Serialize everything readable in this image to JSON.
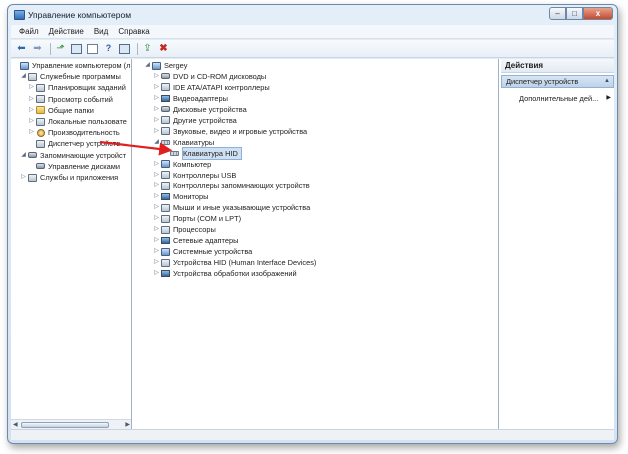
{
  "window": {
    "title": "Управление компьютером",
    "minimize_label": "–",
    "maximize_label": "□",
    "close_label": "x"
  },
  "menu": [
    "Файл",
    "Действие",
    "Вид",
    "Справка"
  ],
  "left_tree": [
    {
      "label": "Управление компьютером (л",
      "level": 0,
      "expander": "",
      "icon": "computer-management-icon"
    },
    {
      "label": "Служебные программы",
      "level": 1,
      "expander": "◢",
      "icon": "tools-icon"
    },
    {
      "label": "Планировщик заданий",
      "level": 2,
      "expander": "▷",
      "icon": "task-scheduler-icon"
    },
    {
      "label": "Просмотр событий",
      "level": 2,
      "expander": "▷",
      "icon": "event-viewer-icon"
    },
    {
      "label": "Общие папки",
      "level": 2,
      "expander": "▷",
      "icon": "shared-folders-icon"
    },
    {
      "label": "Локальные пользовате",
      "level": 2,
      "expander": "▷",
      "icon": "local-users-icon"
    },
    {
      "label": "Производительность",
      "level": 2,
      "expander": "▷",
      "icon": "performance-icon"
    },
    {
      "label": "Диспетчер устройств",
      "level": 2,
      "expander": "",
      "icon": "device-manager-icon"
    },
    {
      "label": "Запоминающие устройст",
      "level": 1,
      "expander": "◢",
      "icon": "storage-icon"
    },
    {
      "label": "Управление дисками",
      "level": 2,
      "expander": "",
      "icon": "disk-management-icon"
    },
    {
      "label": "Службы и приложения",
      "level": 1,
      "expander": "▷",
      "icon": "services-icon"
    }
  ],
  "device_tree": [
    {
      "label": "Sergey",
      "level": 0,
      "expander": "◢",
      "icon": "computer-icon"
    },
    {
      "label": "DVD и CD-ROM дисководы",
      "level": 1,
      "expander": "▷",
      "icon": "dvd-drive-icon"
    },
    {
      "label": "IDE ATA/ATAPI контроллеры",
      "level": 1,
      "expander": "▷",
      "icon": "ide-controller-icon"
    },
    {
      "label": "Видеоадаптеры",
      "level": 1,
      "expander": "▷",
      "icon": "display-adapter-icon"
    },
    {
      "label": "Дисковые устройства",
      "level": 1,
      "expander": "▷",
      "icon": "disk-drive-icon"
    },
    {
      "label": "Другие устройства",
      "level": 1,
      "expander": "▷",
      "icon": "other-devices-icon"
    },
    {
      "label": "Звуковые, видео и игровые устройства",
      "level": 1,
      "expander": "▷",
      "icon": "sound-icon"
    },
    {
      "label": "Клавиатуры",
      "level": 1,
      "expander": "◢",
      "icon": "keyboard-icon"
    },
    {
      "label": "Клавиатура HID",
      "level": 2,
      "expander": "",
      "icon": "keyboard-icon",
      "selected": true
    },
    {
      "label": "Компьютер",
      "level": 1,
      "expander": "▷",
      "icon": "computer-icon"
    },
    {
      "label": "Контроллеры USB",
      "level": 1,
      "expander": "▷",
      "icon": "usb-icon"
    },
    {
      "label": "Контроллеры запоминающих устройств",
      "level": 1,
      "expander": "▷",
      "icon": "storage-controller-icon"
    },
    {
      "label": "Мониторы",
      "level": 1,
      "expander": "▷",
      "icon": "monitor-icon"
    },
    {
      "label": "Мыши и иные указывающие устройства",
      "level": 1,
      "expander": "▷",
      "icon": "mouse-icon"
    },
    {
      "label": "Порты (COM и LPT)",
      "level": 1,
      "expander": "▷",
      "icon": "port-icon"
    },
    {
      "label": "Процессоры",
      "level": 1,
      "expander": "▷",
      "icon": "processor-icon"
    },
    {
      "label": "Сетевые адаптеры",
      "level": 1,
      "expander": "▷",
      "icon": "network-adapter-icon"
    },
    {
      "label": "Системные устройства",
      "level": 1,
      "expander": "▷",
      "icon": "system-devices-icon"
    },
    {
      "label": "Устройства HID (Human Interface Devices)",
      "level": 1,
      "expander": "▷",
      "icon": "hid-icon"
    },
    {
      "label": "Устройства обработки изображений",
      "level": 1,
      "expander": "▷",
      "icon": "imaging-icon"
    }
  ],
  "actions": {
    "header": "Действия",
    "selected": "Диспетчер устройств",
    "more": "Дополнительные дей..."
  },
  "colors": {
    "annotation_arrow": "#e02020",
    "selection": "#cfe0f3"
  }
}
